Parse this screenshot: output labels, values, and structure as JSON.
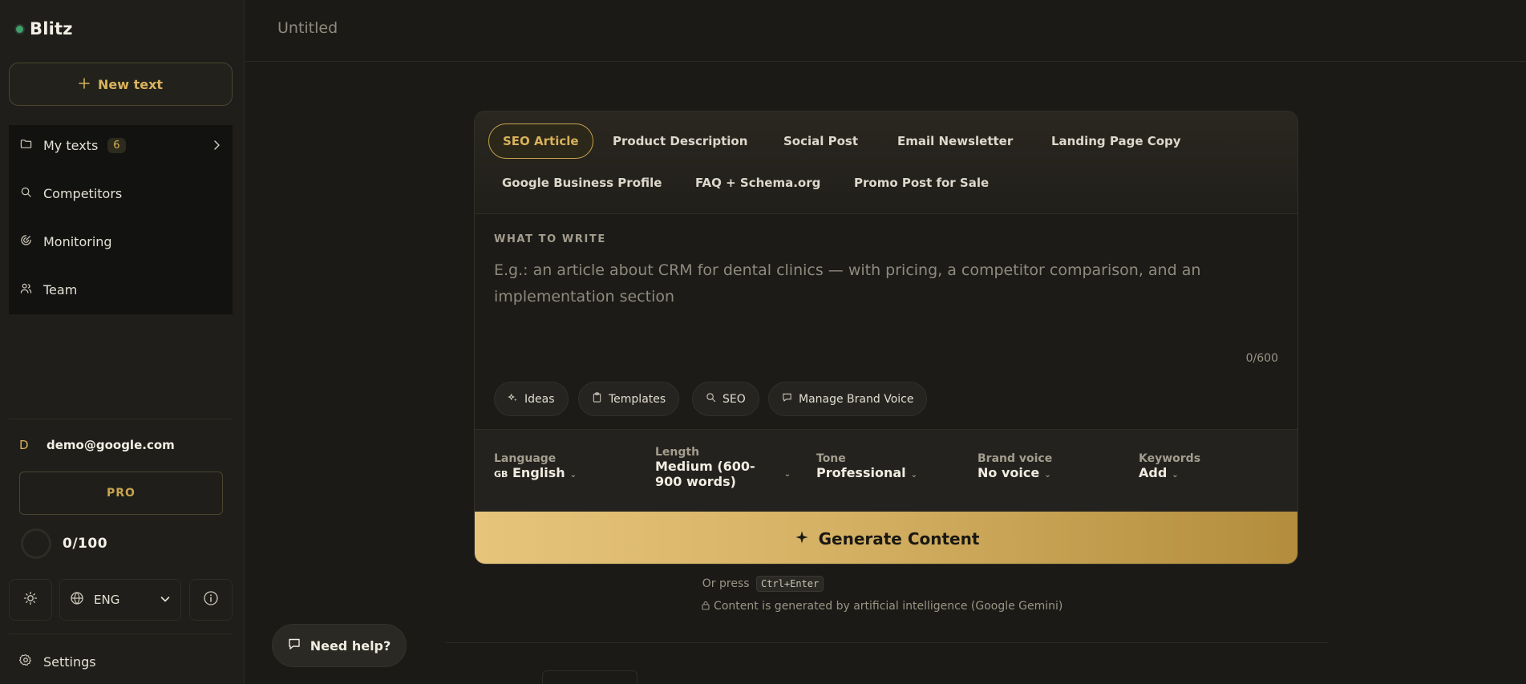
{
  "app": {
    "name": "Blitz"
  },
  "sidebar": {
    "new_text_label": "New text",
    "items": [
      {
        "label": "My texts",
        "badge": "6"
      },
      {
        "label": "Competitors"
      },
      {
        "label": "Monitoring"
      },
      {
        "label": "Team"
      }
    ],
    "user": {
      "initial": "D",
      "email": "demo@google.com"
    },
    "plan_label": "PRO",
    "usage": "0/100",
    "language": "ENG",
    "settings_label": "Settings"
  },
  "header": {
    "doc_title": "Untitled"
  },
  "editor": {
    "tabs": [
      "SEO Article",
      "Product Description",
      "Social Post",
      "Email Newsletter",
      "Landing Page Copy",
      "Google Business Profile",
      "FAQ + Schema.org",
      "Promo Post for Sale"
    ],
    "active_tab": "SEO Article",
    "section_label": "WHAT TO WRITE",
    "placeholder": "E.g.: an article about CRM for dental clinics — with pricing, a competitor comparison, and an implementation section",
    "char_counter": "0/600",
    "chips": [
      "Ideas",
      "Templates",
      "SEO",
      "Manage Brand Voice"
    ],
    "options": {
      "language": {
        "label": "Language",
        "flag": "GB",
        "value": "English"
      },
      "length": {
        "label": "Length",
        "value_line1": "Medium (600-",
        "value_line2": "900 words)"
      },
      "tone": {
        "label": "Tone",
        "value": "Professional"
      },
      "brand_voice": {
        "label": "Brand voice",
        "value": "No voice"
      },
      "keywords": {
        "label": "Keywords",
        "value": "Add"
      }
    },
    "generate_label": "Generate Content",
    "shortcut_prefix": "Or press",
    "shortcut_key": "Ctrl+Enter",
    "ai_notice": "Content is generated by artificial intelligence (Google Gemini)"
  },
  "help": {
    "label": "Need help?"
  },
  "colors": {
    "accent": "#d8b25c",
    "background": "#1b1a17",
    "status_dot": "#3fa06a"
  }
}
